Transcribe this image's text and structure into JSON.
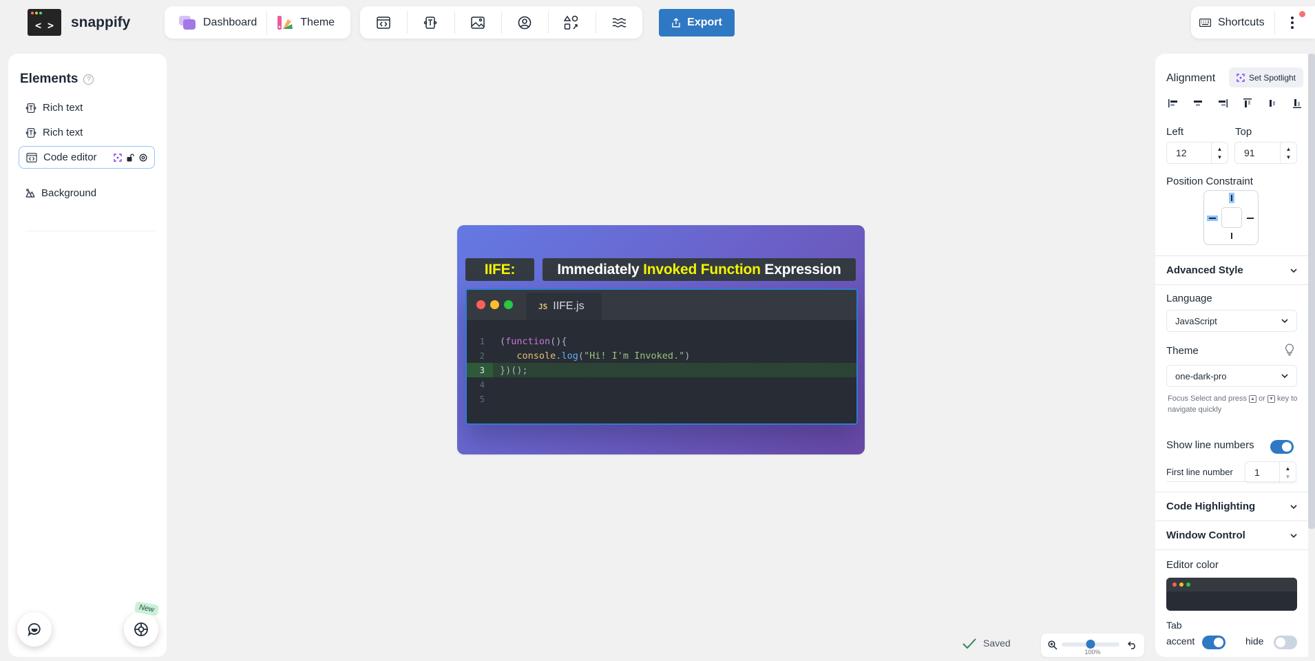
{
  "app": {
    "name": "snappify"
  },
  "topbar": {
    "nav": [
      {
        "label": "Dashboard",
        "icon": "dashboard-icon"
      },
      {
        "label": "Theme",
        "icon": "theme-icon"
      }
    ],
    "tools": [
      {
        "name": "code-editor-tool",
        "icon": "code-window-icon"
      },
      {
        "name": "rich-text-tool",
        "icon": "text-icon"
      },
      {
        "name": "image-tool",
        "icon": "image-icon"
      },
      {
        "name": "avatar-tool",
        "icon": "user-circle-icon"
      },
      {
        "name": "shapes-tool",
        "icon": "shapes-icon"
      },
      {
        "name": "background-tool",
        "icon": "waves-icon"
      }
    ],
    "export_label": "Export",
    "shortcuts_label": "Shortcuts"
  },
  "elements_panel": {
    "title": "Elements",
    "items": [
      {
        "label": "Rich text",
        "icon": "text-icon",
        "selected": false
      },
      {
        "label": "Rich text",
        "icon": "text-icon",
        "selected": false
      },
      {
        "label": "Code editor",
        "icon": "code-window-icon",
        "selected": true
      }
    ],
    "background_label": "Background",
    "new_badge": "New"
  },
  "canvas": {
    "title_chip_1": "IIFE:",
    "title_chip_2": {
      "part1": "Immediately ",
      "part2": "Invoked Function",
      "part3": " Expression"
    },
    "editor": {
      "tab_lang_badge": "JS",
      "tab_filename": "IIFE.js",
      "highlighted_line": 3,
      "lines": [
        {
          "n": "1",
          "tokens": [
            [
              "p",
              "("
            ],
            [
              "kw",
              "function"
            ],
            [
              "p",
              "(){"
            ]
          ]
        },
        {
          "n": "2",
          "tokens": [
            [
              "p",
              "   "
            ],
            [
              "obj",
              "console"
            ],
            [
              "p",
              "."
            ],
            [
              "fn",
              "log"
            ],
            [
              "p",
              "("
            ],
            [
              "str",
              "\"Hi! I'm Invoked.\""
            ],
            [
              "p",
              ")"
            ]
          ]
        },
        {
          "n": "3",
          "tokens": [
            [
              "p",
              "})();"
            ]
          ]
        },
        {
          "n": "4",
          "tokens": []
        },
        {
          "n": "5",
          "tokens": []
        }
      ]
    }
  },
  "properties": {
    "alignment_label": "Alignment",
    "spotlight_label": "Set Spotlight",
    "left_label": "Left",
    "left_value": "12",
    "top_label": "Top",
    "top_value": "91",
    "position_constraint_label": "Position Constraint",
    "advanced_style_label": "Advanced Style",
    "language_label": "Language",
    "language_value": "JavaScript",
    "theme_label": "Theme",
    "theme_value": "one-dark-pro",
    "hint_part1": "Focus Select and press ",
    "hint_or": " or ",
    "hint_part2": " key to navigate quickly",
    "show_line_numbers_label": "Show line numbers",
    "show_line_numbers": true,
    "first_line_label": "First line number",
    "first_line_value": "1",
    "code_highlighting_label": "Code Highlighting",
    "window_control_label": "Window Control",
    "editor_color_label": "Editor color",
    "tab_label": "Tab",
    "accent_label": "accent",
    "accent_on": true,
    "hide_label": "hide",
    "hide_on": false
  },
  "status": {
    "saved_label": "Saved",
    "zoom_label": "100%",
    "zoom_fraction": 0.5
  },
  "colors": {
    "accent": "#2f78c4",
    "editor_bg": "#282c34",
    "title_yellow": "#f4f400"
  }
}
